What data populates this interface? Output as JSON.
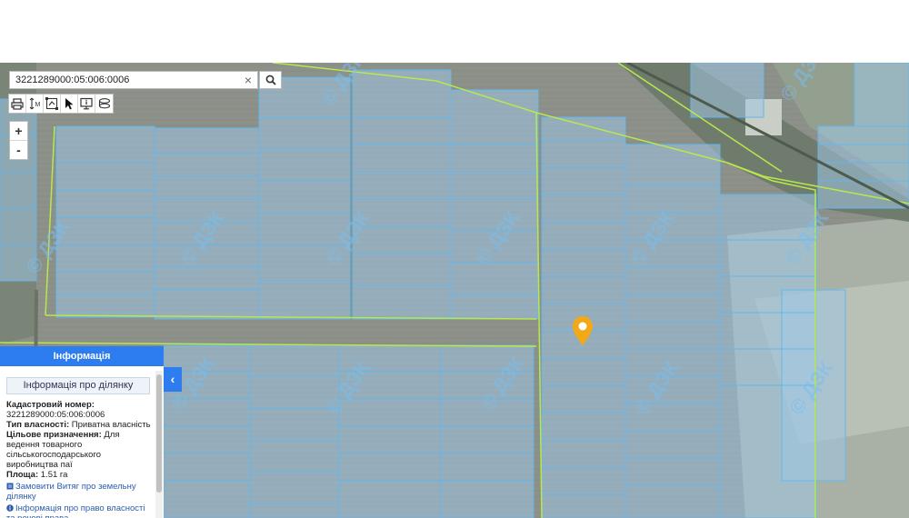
{
  "search": {
    "value": "3221289000:05:006:0006",
    "clear_symbol": "×"
  },
  "toolbar": {
    "tools": [
      "print-icon",
      "measure-icon",
      "select-area-icon",
      "pointer-icon",
      "monitor-info-icon",
      "layers-icon"
    ]
  },
  "zoom": {
    "in": "+",
    "out": "-"
  },
  "watermark": {
    "text": "© ДЗК"
  },
  "panel": {
    "header": "Інформація",
    "subtitle": "Інформація про ділянку",
    "cadastral_label": "Кадастровий номер:",
    "cadastral_value": "3221289000:05:006:0006",
    "ownership_label": "Тип власності:",
    "ownership_value": "Приватна власність",
    "purpose_label": "Цільове призначення:",
    "purpose_value": "Для ведення товарного сільськогосподарського виробництва паї",
    "area_label": "Площа:",
    "area_value": "1.51 га",
    "link_extract": "Замовити Витяг про земельну ділянку",
    "link_rights": "Інформація про право власності та речові права",
    "collapse_symbol": "‹"
  },
  "colors": {
    "accent": "#2d7cf0",
    "parcel_fill": "#9fc6e4",
    "parcel_stroke": "#63b6ec",
    "boundary_line": "#b8e84c",
    "marker": "#f2a918"
  }
}
